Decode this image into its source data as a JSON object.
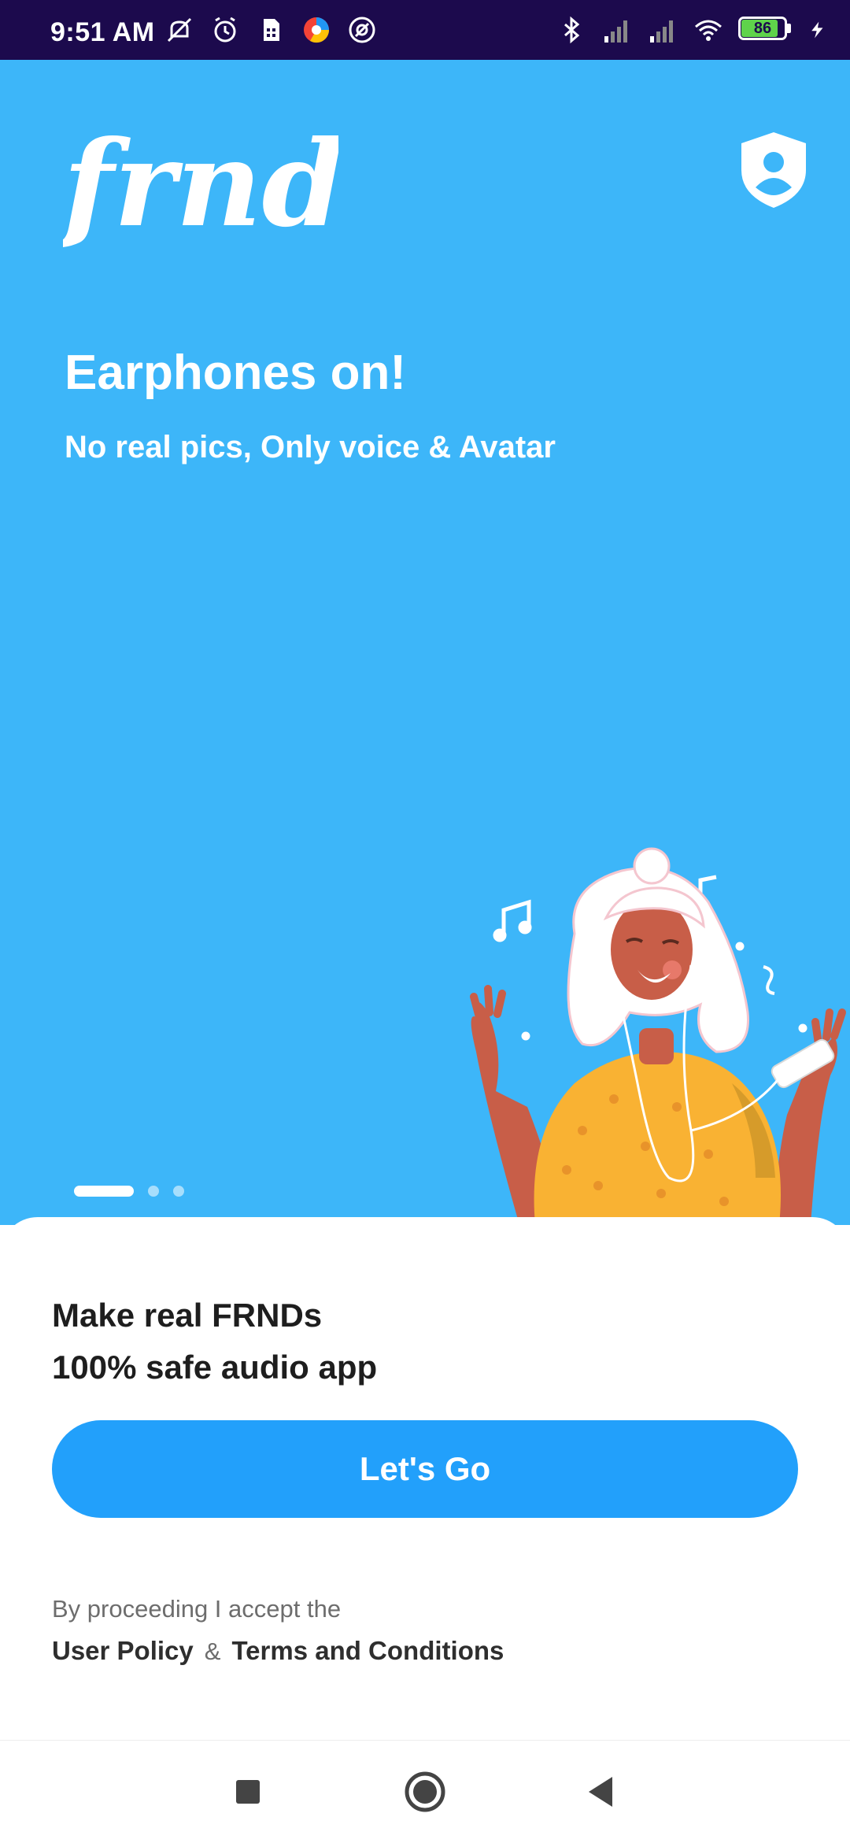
{
  "status_bar": {
    "time": "9:51 AM",
    "battery_level": "86",
    "battery_fraction": 0.86,
    "left_icons": [
      "mute-icon",
      "alarm-icon",
      "sim-icon",
      "browser-icon",
      "at-icon"
    ],
    "right_icons": [
      "bluetooth-icon",
      "signal-icon",
      "signal-icon",
      "wifi-icon",
      "battery-icon",
      "charging-icon"
    ]
  },
  "colors": {
    "status_bar_bg": "#1c0a4d",
    "hero_bg": "#3db6f9",
    "button_bg": "#22a0fb",
    "text_dark": "#1e1e1e",
    "text_muted": "#6d6d6d"
  },
  "hero": {
    "logo": "frnd",
    "title": "Earphones on!",
    "subtitle": "No real pics, Only voice & Avatar",
    "pager": {
      "count": 3,
      "active_index": 0
    }
  },
  "sheet": {
    "title_line1": "Make real FRNDs",
    "title_line2": "100% safe audio app",
    "button_label": "Let's Go",
    "consent_text": "By proceeding I accept the",
    "user_policy_label": "User Policy",
    "ampersand": "&",
    "terms_label": "Terms and Conditions"
  },
  "nav_bar": {
    "icons": [
      "recents-square-icon",
      "home-circle-icon",
      "back-triangle-icon"
    ]
  }
}
